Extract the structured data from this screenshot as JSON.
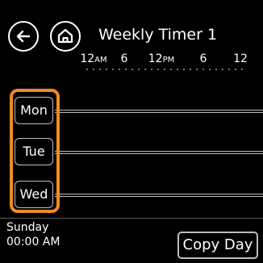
{
  "header": {
    "title": "Weekly Timer 1",
    "back_icon": "back-arrow-icon",
    "home_icon": "home-icon"
  },
  "timescale": {
    "labels": [
      {
        "value": "12",
        "suffix": "AM"
      },
      {
        "value": "6",
        "suffix": ""
      },
      {
        "value": "12",
        "suffix": "PM"
      },
      {
        "value": "6",
        "suffix": ""
      },
      {
        "value": "12",
        "suffix": ""
      }
    ]
  },
  "days": [
    {
      "label": "Mon"
    },
    {
      "label": "Tue"
    },
    {
      "label": "Wed"
    }
  ],
  "footer": {
    "current_day": "Sunday",
    "current_time": "00:00 AM",
    "copy_button_label": "Copy Day"
  },
  "colors": {
    "background": "#000000",
    "highlight": "#f08a24",
    "foreground": "#ffffff"
  }
}
